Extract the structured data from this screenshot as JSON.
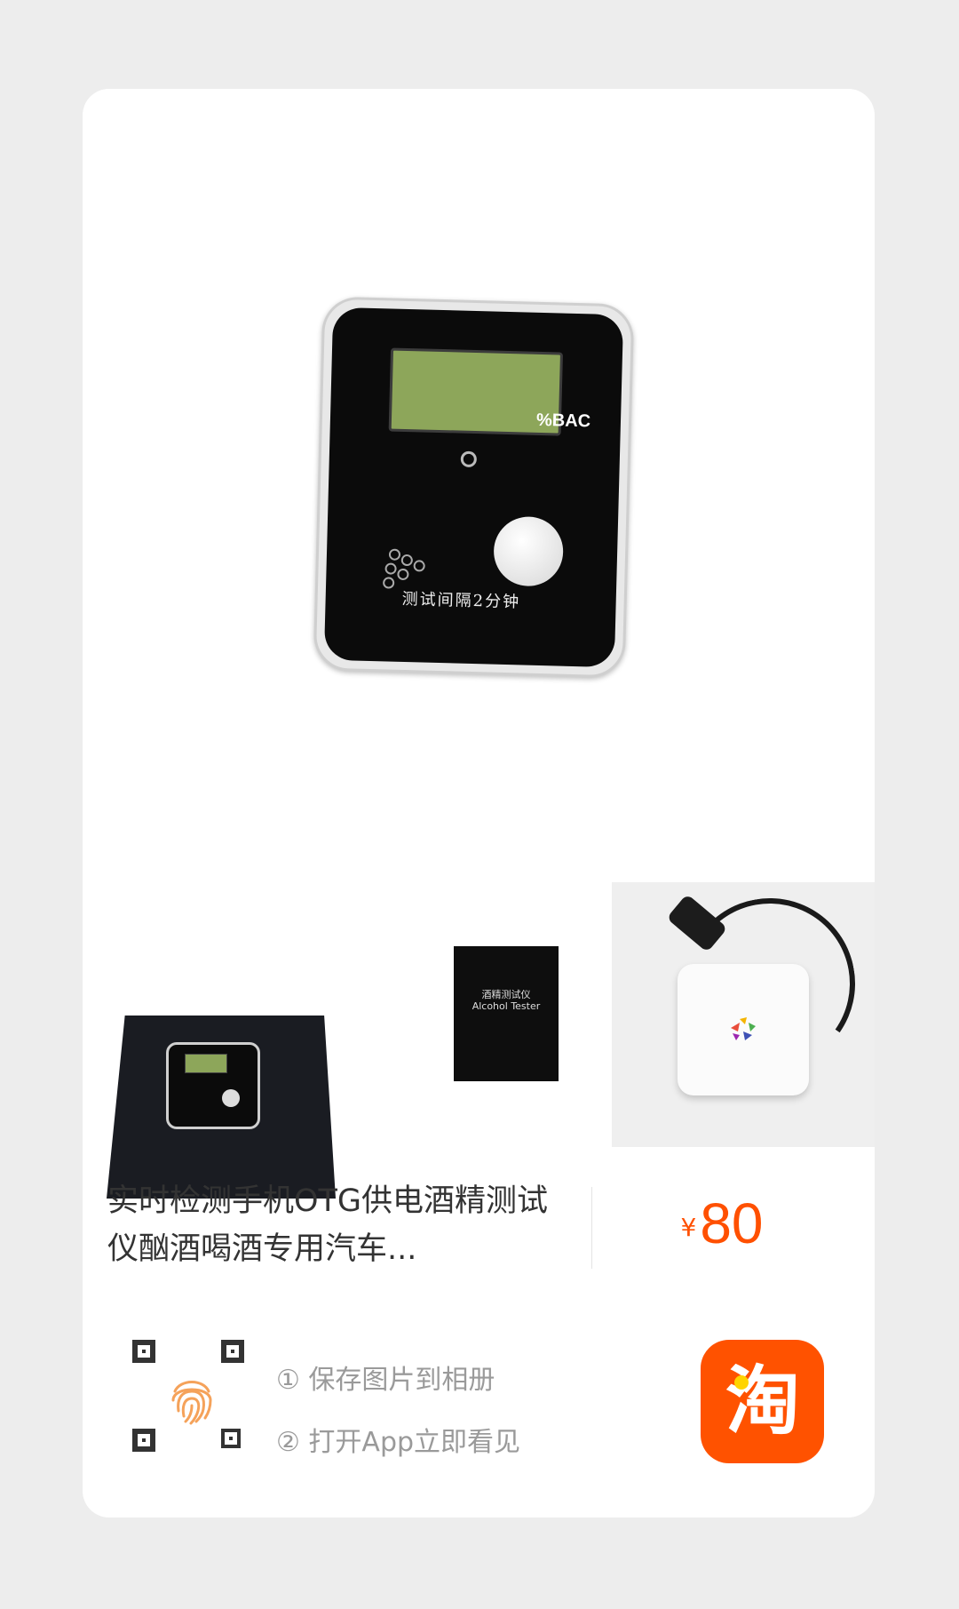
{
  "product": {
    "main_image_caption": "测试间隔2分钟",
    "main_image_badge": "%BAC",
    "box_label_cn": "酒精测试仪",
    "box_label_en": "Alcohol Tester",
    "title": "实时检测手机OTG供电酒精测试仪酗酒喝酒专用汽车...",
    "price_currency": "¥",
    "price_amount": "80"
  },
  "share": {
    "step1": "① 保存图片到相册",
    "step2": "② 打开App立即看见",
    "app_icon_label": "淘"
  },
  "colors": {
    "accent": "#ff5000",
    "app_icon_bg": "#ff5200",
    "background": "#ededed",
    "card": "#ffffff"
  },
  "icons": [
    "qr-code-icon",
    "fingerprint-icon",
    "taobao-app-icon"
  ]
}
